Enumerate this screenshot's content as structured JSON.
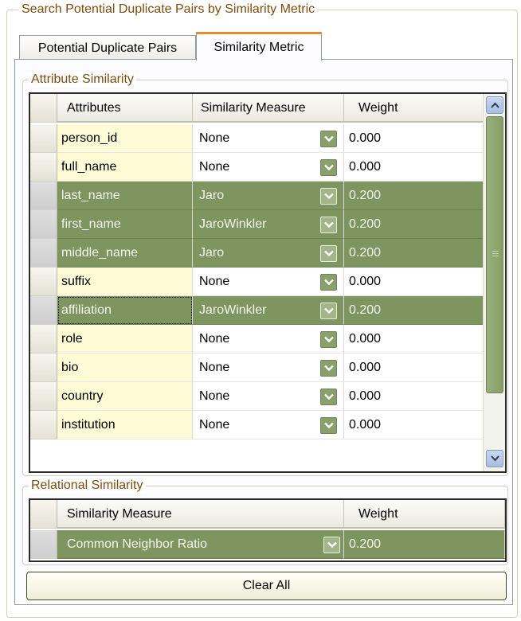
{
  "outer_group_title": "Search Potential Duplicate Pairs by Similarity Metric",
  "tabs": [
    {
      "label": "Potential Duplicate Pairs",
      "active": false
    },
    {
      "label": "Similarity Metric",
      "active": true
    }
  ],
  "attribute_group": {
    "title": "Attribute Similarity",
    "columns": [
      "Attributes",
      "Similarity Measure",
      "Weight"
    ],
    "rows": [
      {
        "attribute": "person_id",
        "measure": "None",
        "weight": "0.000",
        "selected": false
      },
      {
        "attribute": "full_name",
        "measure": "None",
        "weight": "0.000",
        "selected": false
      },
      {
        "attribute": "last_name",
        "measure": "Jaro",
        "weight": "0.200",
        "selected": true
      },
      {
        "attribute": "first_name",
        "measure": "JaroWinkler",
        "weight": "0.200",
        "selected": true
      },
      {
        "attribute": "middle_name",
        "measure": "Jaro",
        "weight": "0.200",
        "selected": true
      },
      {
        "attribute": "suffix",
        "measure": "None",
        "weight": "0.000",
        "selected": false
      },
      {
        "attribute": "affiliation",
        "measure": "JaroWinkler",
        "weight": "0.200",
        "selected": true,
        "focused": true
      },
      {
        "attribute": "role",
        "measure": "None",
        "weight": "0.000",
        "selected": false
      },
      {
        "attribute": "bio",
        "measure": "None",
        "weight": "0.000",
        "selected": false
      },
      {
        "attribute": "country",
        "measure": "None",
        "weight": "0.000",
        "selected": false
      },
      {
        "attribute": "institution",
        "measure": "None",
        "weight": "0.000",
        "selected": false
      }
    ]
  },
  "relational_group": {
    "title": "Relational Similarity",
    "columns": [
      "Similarity Measure",
      "Weight"
    ],
    "rows": [
      {
        "measure": "Common Neighbor Ratio",
        "weight": "0.200",
        "selected": true
      }
    ]
  },
  "clear_button_label": "Clear All",
  "colors": {
    "selected_row": "#7e955f",
    "attribute_cell": "#fefbd6",
    "active_tab_accent": "#e68b2c",
    "group_title": "#7a4d10"
  },
  "icons": {
    "dropdown": "chevron-down-icon",
    "scroll_up": "scroll-up-arrow-icon",
    "scroll_down": "scroll-down-arrow-icon"
  }
}
